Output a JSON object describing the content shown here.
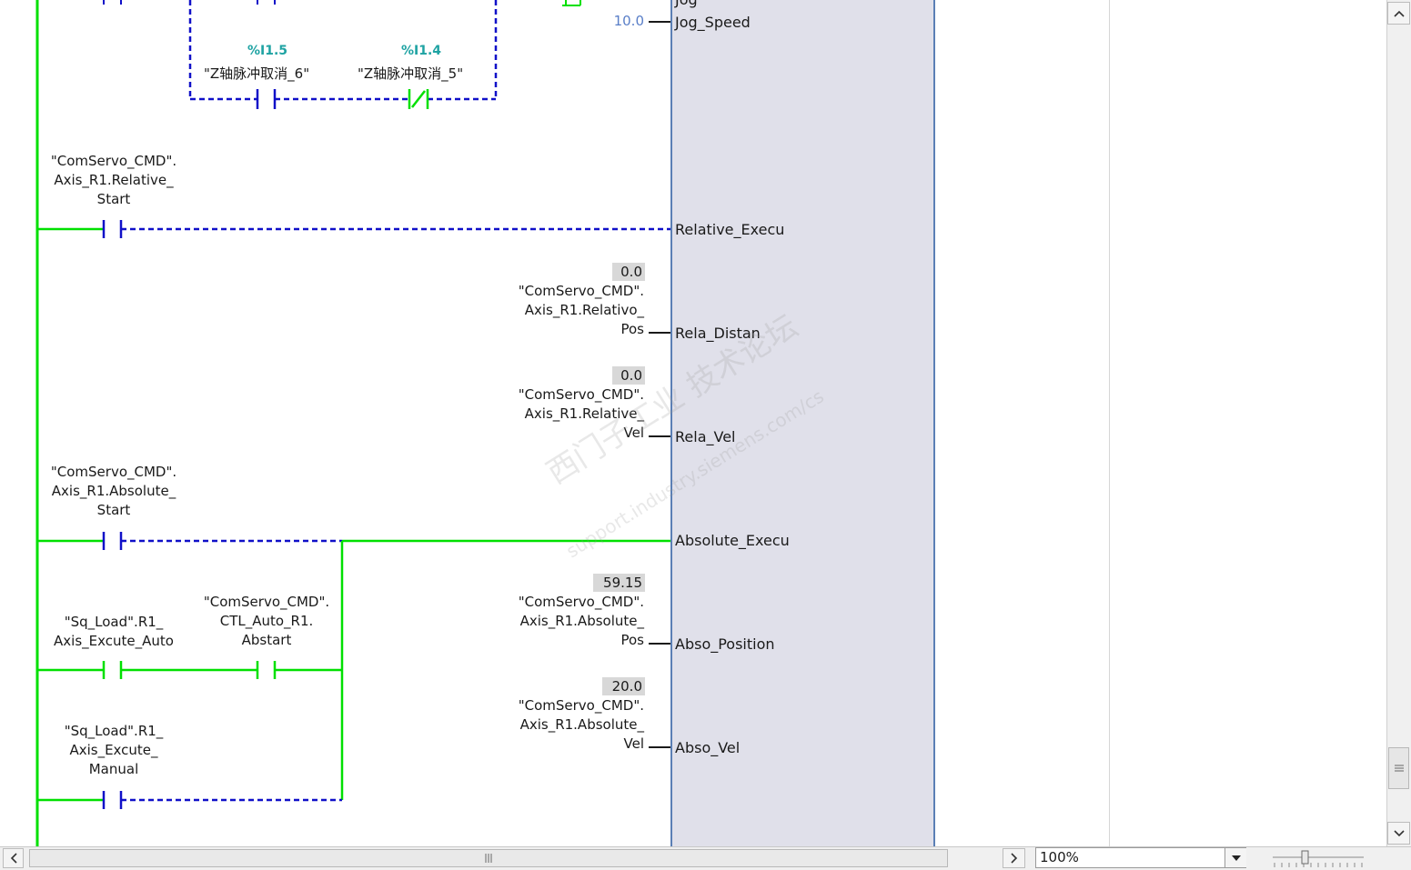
{
  "function_block": {
    "pins": {
      "jog_top": "Jog",
      "jog_speed": "Jog_Speed",
      "relative_execu": "Relative_Execu",
      "rela_distan": "Rela_Distan",
      "rela_vel": "Rela_Vel",
      "absolute_execu": "Absolute_Execu",
      "abso_position": "Abso_Position",
      "abso_vel": "Abso_Vel"
    }
  },
  "contacts": {
    "i15": {
      "address": "%I1.5",
      "name": "\"Z轴脉冲取消_6\""
    },
    "i14": {
      "address": "%I1.4",
      "name": "\"Z轴脉冲取消_5\""
    },
    "relative_start": {
      "line1": "\"ComServo_CMD\".",
      "line2": "Axis_R1.Relative_",
      "line3": "Start"
    },
    "absolute_start": {
      "line1": "\"ComServo_CMD\".",
      "line2": "Axis_R1.Absolute_",
      "line3": "Start"
    },
    "sq_auto": {
      "line1": "\"Sq_Load\".R1_",
      "line2": "Axis_Excute_Auto"
    },
    "ctl_auto": {
      "line1": "\"ComServo_CMD\".",
      "line2": "CTL_Auto_R1.",
      "line3": "Abstart"
    },
    "sq_manual": {
      "line1": "\"Sq_Load\".R1_",
      "line2": "Axis_Excute_",
      "line3": "Manual"
    }
  },
  "operands": {
    "jog_speed_value": "10.0",
    "rela_pos": {
      "value": "0.0",
      "line1": "\"ComServo_CMD\".",
      "line2": "Axis_R1.Relativo_",
      "line3": "Pos"
    },
    "rela_vel": {
      "value": "0.0",
      "line1": "\"ComServo_CMD\".",
      "line2": "Axis_R1.Relative_",
      "line3": "Vel"
    },
    "abso_pos": {
      "value": "59.15",
      "line1": "\"ComServo_CMD\".",
      "line2": "Axis_R1.Absolute_",
      "line3": "Pos"
    },
    "abso_vel": {
      "value": "20.0",
      "line1": "\"ComServo_CMD\".",
      "line2": "Axis_R1.Absolute_",
      "line3": "Vel"
    }
  },
  "watermark": {
    "line1": "西门子工业 技术论坛",
    "line2": "support.industry.siemens.com/cs"
  },
  "statusbar": {
    "zoom": "100%"
  },
  "colors": {
    "powered": "#00e000",
    "unpowered": "#1010c8",
    "block_fill": "#e0e0ea",
    "block_border": "#5b7fb5"
  }
}
